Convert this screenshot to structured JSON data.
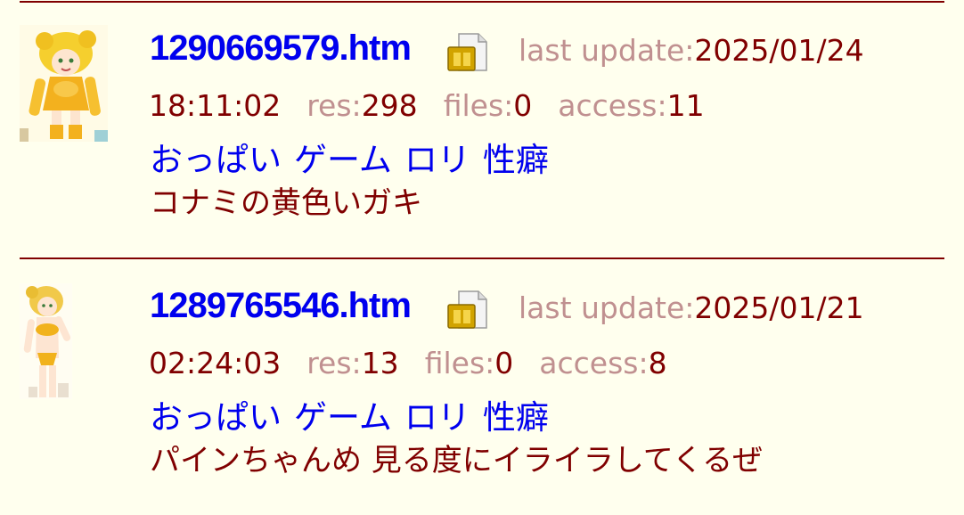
{
  "entries": [
    {
      "filename": "1290669579.htm",
      "file_icon": "file-document-icon",
      "last_update_label": "last update:",
      "last_update_date": "2025/01/24",
      "last_update_time": "18:11:02",
      "res_label": "res:",
      "res_value": "298",
      "files_label": "files:",
      "files_value": "0",
      "access_label": "access:",
      "access_value": "11",
      "tags": [
        "おっぱい",
        "ゲーム",
        "ロリ",
        "性癖"
      ],
      "comment": "コナミの黄色いガキ",
      "thumbnail": "character-thumbnail-yellow-outfit"
    },
    {
      "filename": "1289765546.htm",
      "file_icon": "file-document-icon",
      "last_update_label": "last update:",
      "last_update_date": "2025/01/21",
      "last_update_time": "02:24:03",
      "res_label": "res:",
      "res_value": "13",
      "files_label": "files:",
      "files_value": "0",
      "access_label": "access:",
      "access_value": "8",
      "tags": [
        "おっぱい",
        "ゲーム",
        "ロリ",
        "性癖"
      ],
      "comment": "パインちゃんめ 見る度にイライラしてくるぜ",
      "thumbnail": "character-thumbnail-yellow-bikini"
    }
  ],
  "colors": {
    "background": "#ffffee",
    "divider": "#800000",
    "link": "#0000ee",
    "label": "#c09090",
    "value": "#800000"
  }
}
